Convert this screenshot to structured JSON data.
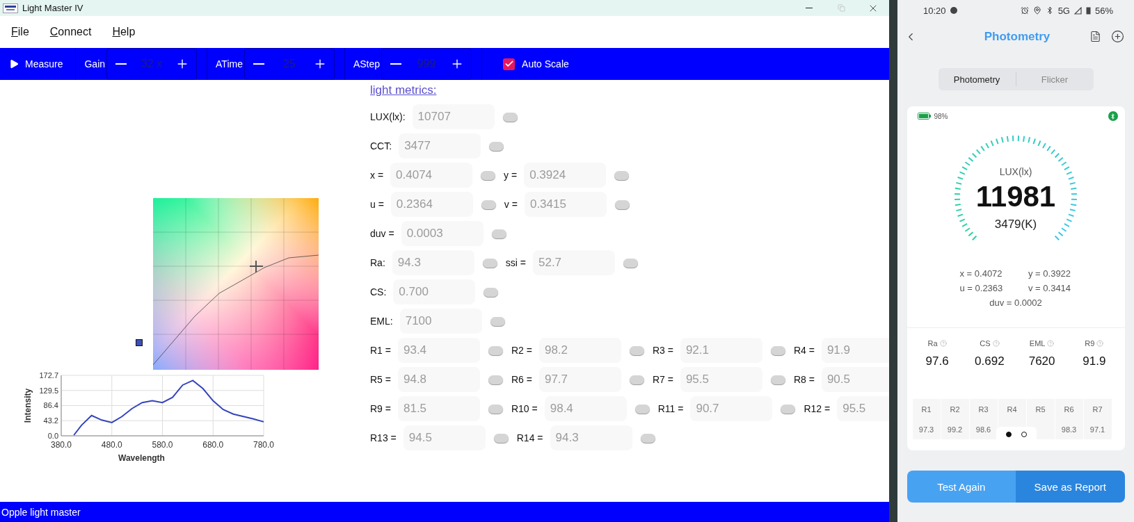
{
  "window": {
    "title": "Light Master IV"
  },
  "menu": [
    "File",
    "Connect",
    "Help"
  ],
  "toolbar": {
    "measure": "Measure",
    "steppers": [
      {
        "label": "Gain",
        "value": "32 x"
      },
      {
        "label": "ATime",
        "value": "25"
      },
      {
        "label": "AStep",
        "value": "999"
      }
    ],
    "auto_scale": {
      "label": "Auto Scale",
      "checked": true
    }
  },
  "spectrum": {
    "chart_data": {
      "type": "line",
      "xlabel": "Wavelength",
      "ylabel": "Intensity",
      "x": [
        405,
        420,
        440,
        460,
        480,
        500,
        520,
        540,
        560,
        580,
        600,
        620,
        640,
        660,
        680,
        700,
        720,
        740,
        760,
        780
      ],
      "series": [
        {
          "color": "#3344bb",
          "values": [
            2,
            30,
            58,
            45,
            38,
            55,
            78,
            95,
            100,
            95,
            110,
            145,
            158,
            135,
            100,
            75,
            62,
            55,
            48,
            40
          ]
        }
      ],
      "xlim": [
        380,
        780
      ],
      "ylim": [
        0,
        172.7
      ],
      "xticks": [
        {
          "value": 380,
          "label": "380.0"
        },
        {
          "value": 480,
          "label": "480.0"
        },
        {
          "value": 580,
          "label": "580.0"
        },
        {
          "value": 680,
          "label": "680.0"
        },
        {
          "value": 780,
          "label": "780.0"
        }
      ],
      "grid": true,
      "yticks": [
        {
          "value": 0,
          "label": "0.0"
        },
        {
          "value": 43.2,
          "label": "43.2"
        },
        {
          "value": 86.4,
          "label": "86.4"
        },
        {
          "value": 129.5,
          "label": "129.5"
        },
        {
          "value": 172.7,
          "label": "172.7"
        }
      ]
    }
  },
  "metrics": {
    "heading": "light metrics:",
    "rows": [
      [
        {
          "label": "LUX(lx):",
          "value": "10707"
        }
      ],
      [
        {
          "label": "CCT:",
          "value": "3477"
        }
      ],
      [
        {
          "label": "x =",
          "value": "0.4074"
        },
        {
          "label": "y =",
          "value": "0.3924"
        }
      ],
      [
        {
          "label": "u =",
          "value": "0.2364"
        },
        {
          "label": "v =",
          "value": "0.3415"
        }
      ],
      [
        {
          "label": "duv =",
          "value": "0.0003"
        }
      ],
      [
        {
          "label": "Ra:",
          "value": "94.3"
        },
        {
          "label": "ssi =",
          "value": "52.7"
        }
      ],
      [
        {
          "label": "CS:",
          "value": "0.700"
        }
      ],
      [
        {
          "label": "EML:",
          "value": "7100"
        }
      ],
      [
        {
          "label": "R1 =",
          "value": "93.4"
        },
        {
          "label": "R2 =",
          "value": "98.2"
        },
        {
          "label": "R3 =",
          "value": "92.1"
        },
        {
          "label": "R4 =",
          "value": "91.9"
        }
      ],
      [
        {
          "label": "R5 =",
          "value": "94.8"
        },
        {
          "label": "R6 =",
          "value": "97.7"
        },
        {
          "label": "R7 =",
          "value": "95.5"
        },
        {
          "label": "R8 =",
          "value": "90.5"
        }
      ],
      [
        {
          "label": "R9 =",
          "value": "81.5"
        },
        {
          "label": "R10 =",
          "value": "98.4"
        },
        {
          "label": "R11 =",
          "value": "90.7"
        },
        {
          "label": "R12 =",
          "value": "95.5"
        }
      ],
      [
        {
          "label": "R13 =",
          "value": "94.5"
        },
        {
          "label": "R14 =",
          "value": "94.3"
        }
      ]
    ]
  },
  "status_bar": "Opple light master",
  "phone": {
    "status": {
      "time": "10:20",
      "network": "5G",
      "battery": "56%"
    },
    "title": "Photometry",
    "tabs": [
      {
        "label": "Photometry",
        "selected": true
      },
      {
        "label": "Flicker",
        "selected": false
      }
    ],
    "device_battery": "98%",
    "lux_label": "LUX(lx)",
    "lux": "11981",
    "cct": "3479(K)",
    "coords": [
      "x = 0.4072",
      "y = 0.3922",
      "u = 0.2363",
      "v = 0.3414"
    ],
    "duv": "duv = 0.0002",
    "indices": [
      {
        "label": "Ra",
        "value": "97.6"
      },
      {
        "label": "CS",
        "value": "0.692"
      },
      {
        "label": "EML",
        "value": "7620"
      },
      {
        "label": "R9",
        "value": "91.9"
      }
    ],
    "cri_table": [
      {
        "label": "R1",
        "value": "97.3"
      },
      {
        "label": "R2",
        "value": "99.2"
      },
      {
        "label": "R3",
        "value": "98.6"
      },
      {
        "label": "R4"
      },
      {
        "label": "R5"
      },
      {
        "label": "R6",
        "value": "98.3"
      },
      {
        "label": "R7",
        "value": "97.1"
      }
    ],
    "pager": [
      {
        "selected": true
      },
      {
        "selected": false
      }
    ],
    "buttons": [
      {
        "label": "Test Again",
        "kind": "secondary"
      },
      {
        "label": "Save as Report",
        "kind": "primary"
      }
    ]
  }
}
